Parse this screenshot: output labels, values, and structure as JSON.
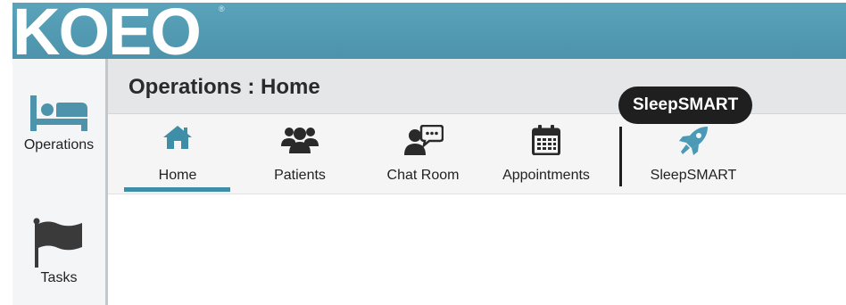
{
  "app": {
    "logo_text": "KOEO",
    "registered_mark": "®"
  },
  "sidebar": {
    "items": [
      {
        "label": "Operations",
        "icon": "bed-icon"
      },
      {
        "label": "Tasks",
        "icon": "flag-icon"
      }
    ]
  },
  "page": {
    "title": "Operations : Home"
  },
  "nav": {
    "active": "Home",
    "items": [
      {
        "label": "Home",
        "icon": "home-icon"
      },
      {
        "label": "Patients",
        "icon": "users-icon"
      },
      {
        "label": "Chat Room",
        "icon": "chat-icon"
      },
      {
        "label": "Appointments",
        "icon": "calendar-icon"
      },
      {
        "label": "SleepSMART",
        "icon": "rocket-icon"
      }
    ]
  },
  "tooltip": {
    "text": "SleepSMART"
  },
  "colors": {
    "header": "#5aa3ba",
    "accent": "#3f8ea8",
    "icon": "#2a2a2a",
    "tooltip_bg": "#1f1f1f"
  }
}
